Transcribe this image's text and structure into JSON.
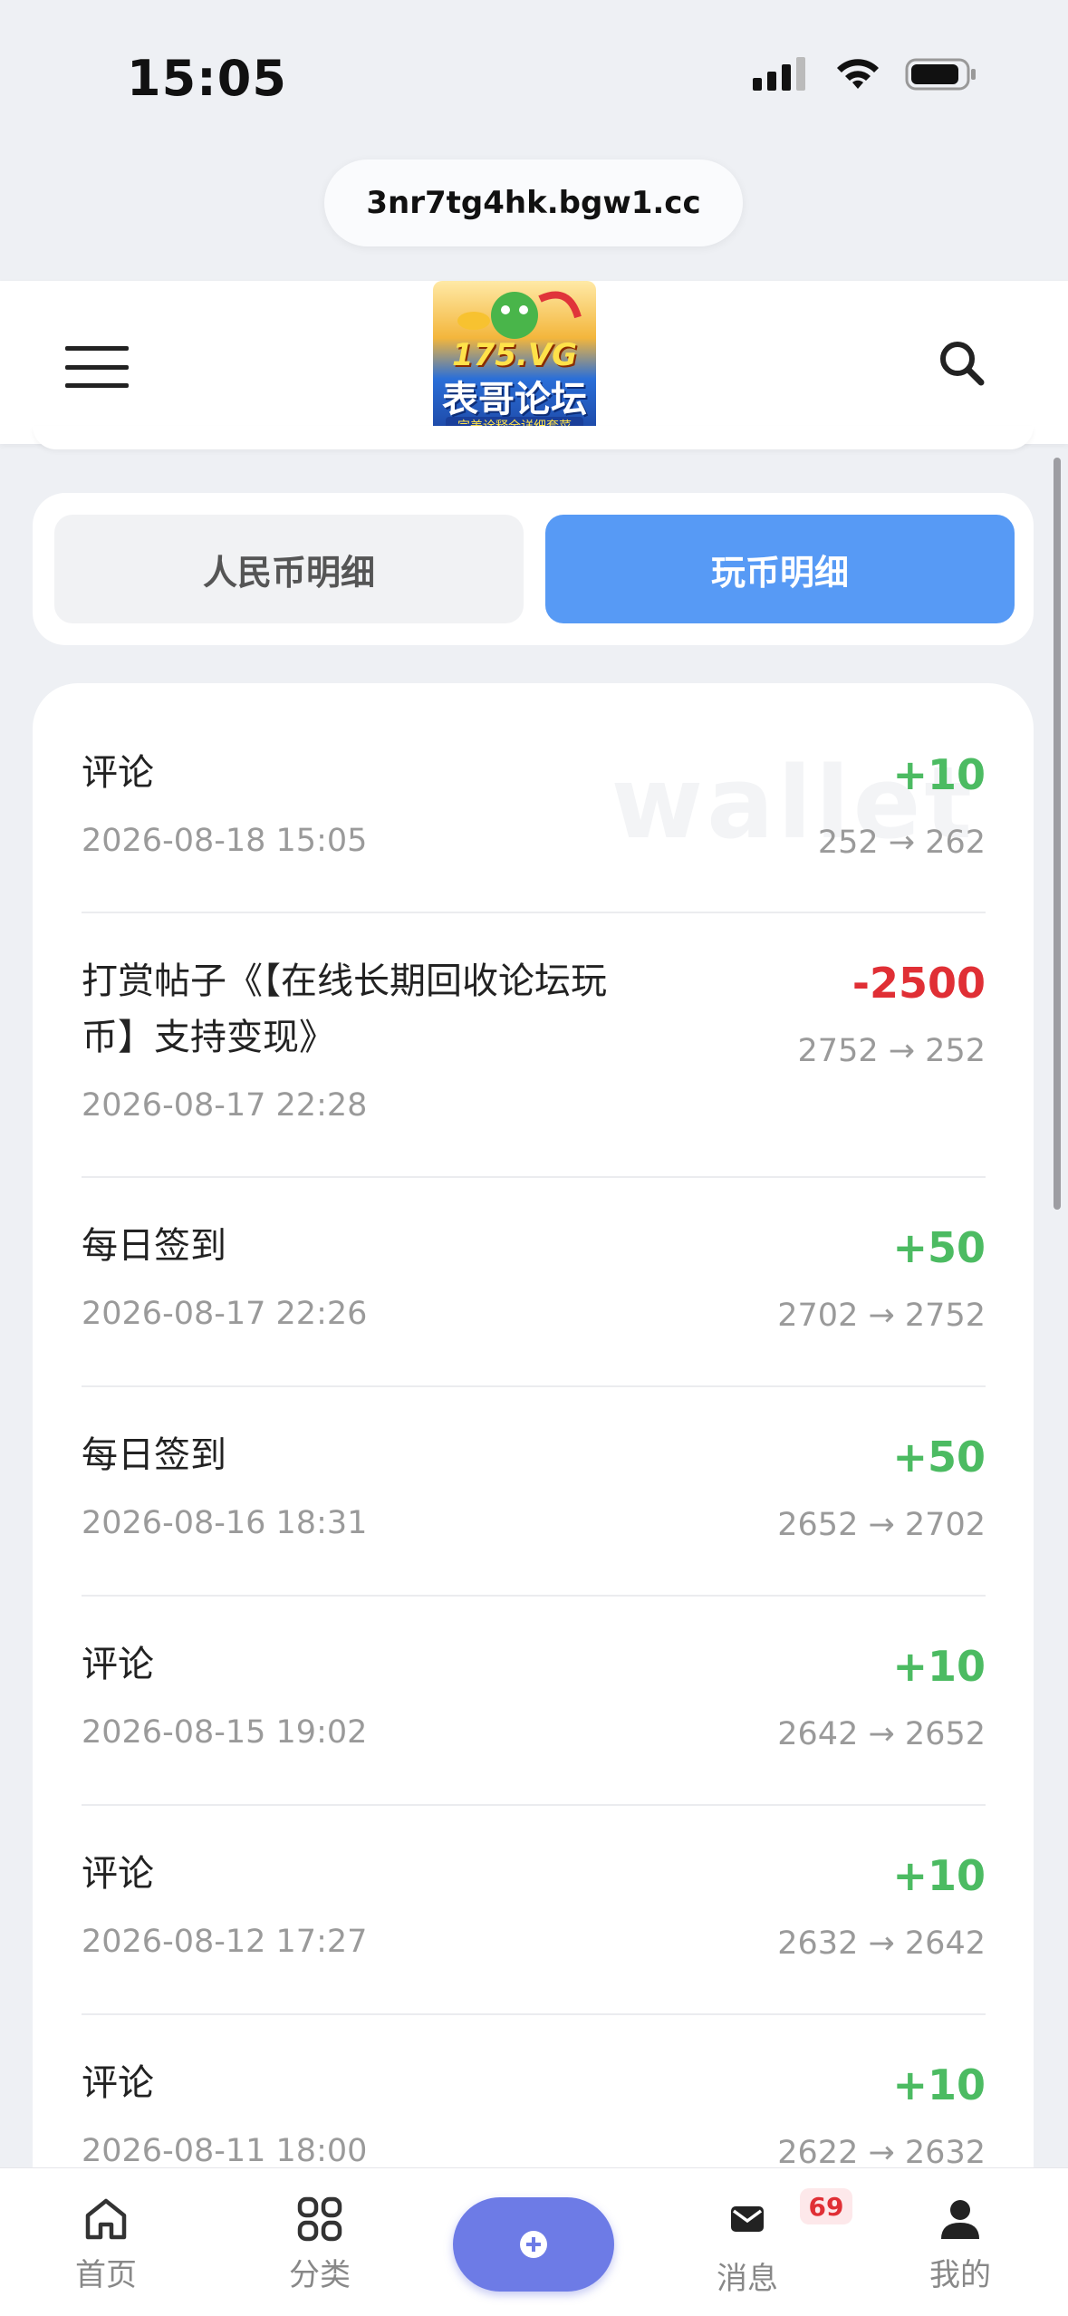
{
  "status_bar": {
    "time": "15:05"
  },
  "browser": {
    "url": "3nr7tg4hk.bgw1.cc"
  },
  "header": {
    "logo_top": "175.VG",
    "logo_main": "表哥论坛",
    "logo_sub": "完美诠释全详细套菜"
  },
  "tabs": [
    {
      "label": "人民币明细",
      "active": false
    },
    {
      "label": "玩币明细",
      "active": true
    }
  ],
  "watermark": "wallet",
  "records": [
    {
      "title": "评论",
      "date": "2026-08-18 15:05",
      "amount": "+10",
      "balance": "252 → 262",
      "type": "pos"
    },
    {
      "title": "打赏帖子《【在线长期回收论坛玩币】支持变现》",
      "title_line1": "打赏帖子《【在线长期回收论坛玩",
      "title_line2": "币】支持变现》",
      "date": "2026-08-17 22:28",
      "amount": "-2500",
      "balance": "2752 → 252",
      "type": "neg"
    },
    {
      "title": "每日签到",
      "date": "2026-08-17 22:26",
      "amount": "+50",
      "balance": "2702 → 2752",
      "type": "pos"
    },
    {
      "title": "每日签到",
      "date": "2026-08-16 18:31",
      "amount": "+50",
      "balance": "2652 → 2702",
      "type": "pos"
    },
    {
      "title": "评论",
      "date": "2026-08-15 19:02",
      "amount": "+10",
      "balance": "2642 → 2652",
      "type": "pos"
    },
    {
      "title": "评论",
      "date": "2026-08-12 17:27",
      "amount": "+10",
      "balance": "2632 → 2642",
      "type": "pos"
    },
    {
      "title": "评论",
      "date": "2026-08-11 18:00",
      "amount": "+10",
      "balance": "2622 → 2632",
      "type": "pos"
    }
  ],
  "bottom_nav": {
    "home": "首页",
    "category": "分类",
    "messages": "消息",
    "messages_badge": "69",
    "mine": "我的"
  },
  "colors": {
    "accent_blue": "#579af5",
    "positive": "#4cbb62",
    "negative": "#e02f35",
    "fab": "#6d7be6"
  }
}
